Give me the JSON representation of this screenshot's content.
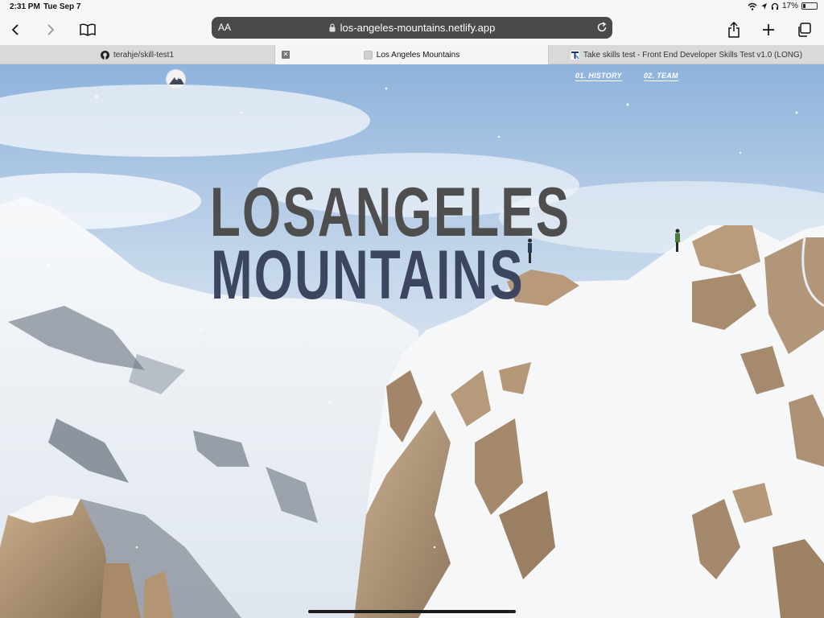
{
  "status_bar": {
    "time": "2:31 PM",
    "date": "Tue Sep 7",
    "battery": "17%",
    "battery_level": 0.17
  },
  "toolbar": {
    "text_size_label": "AA",
    "url": "los-angeles-mountains.netlify.app",
    "icons": [
      "back-icon",
      "forward-icon",
      "bookmarks-icon",
      "lock-icon",
      "reload-icon",
      "share-icon",
      "new-tab-icon",
      "tabs-icon"
    ]
  },
  "tabs": [
    {
      "label": "terahje/skill-test1",
      "icon": "github-icon"
    },
    {
      "label": "Los Angeles Mountains",
      "icon": "page-icon",
      "active": true
    },
    {
      "label": "Take skills test - Front End Developer Skills Test v1.0 (LONG)",
      "icon": "testdome-icon"
    }
  ],
  "page": {
    "nav": [
      "01. HISTORY",
      "02. TEAM"
    ],
    "title_line1": "LOSANGELES",
    "title_line2": "MOUNTAINS"
  },
  "colors": {
    "title_top": "#4e4e4e",
    "title_bottom": "#3d4660",
    "url_bar": "#4a4a4a",
    "sky": "#9fbfe0"
  }
}
